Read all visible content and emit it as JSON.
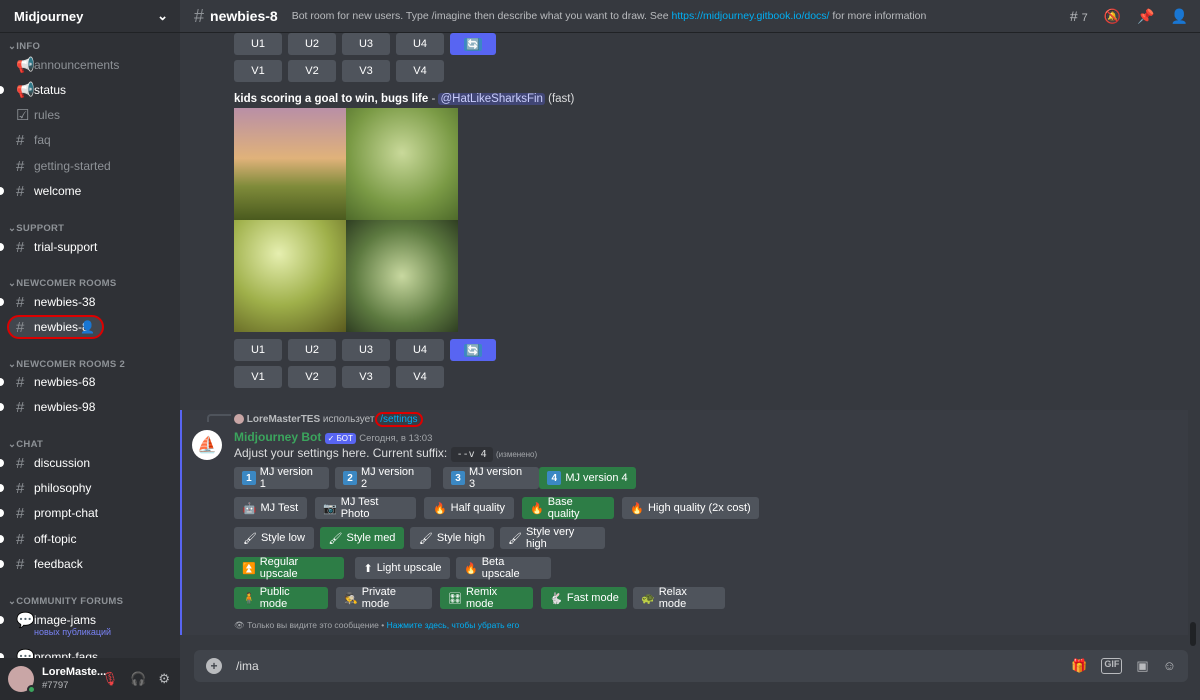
{
  "server": {
    "name": "Midjourney"
  },
  "sidebar": {
    "categories": [
      "INFO",
      "SUPPORT",
      "NEWCOMER ROOMS",
      "NEWCOMER ROOMS 2",
      "CHAT",
      "COMMUNITY FORUMS"
    ],
    "channels": [
      {
        "name": "announcements",
        "icon": "megaphone-icon"
      },
      {
        "name": "status",
        "icon": "megaphone-icon",
        "unread": true
      },
      {
        "name": "rules",
        "icon": "checkbox-icon"
      },
      {
        "name": "faq",
        "icon": "hash-icon"
      },
      {
        "name": "getting-started",
        "icon": "hash-icon"
      },
      {
        "name": "welcome",
        "icon": "hash-icon",
        "unread": true
      },
      {
        "name": "trial-support",
        "icon": "hash-icon",
        "unread": true
      },
      {
        "name": "newbies-38",
        "icon": "threads-icon",
        "unread": true
      },
      {
        "name": "newbies-8",
        "icon": "threads-icon",
        "active": true
      },
      {
        "name": "newbies-68",
        "icon": "threads-icon",
        "unread": true
      },
      {
        "name": "newbies-98",
        "icon": "threads-icon",
        "unread": true
      },
      {
        "name": "discussion",
        "icon": "threads-icon",
        "unread": true
      },
      {
        "name": "philosophy",
        "icon": "hash-icon",
        "unread": true
      },
      {
        "name": "prompt-chat",
        "icon": "threads-icon",
        "unread": true
      },
      {
        "name": "off-topic",
        "icon": "threads-icon",
        "unread": true
      },
      {
        "name": "feedback",
        "icon": "threads-icon",
        "unread": true
      },
      {
        "name": "image-jams",
        "icon": "forum-icon",
        "unread": true,
        "sub": "новых публикаций"
      },
      {
        "name": "prompt-faqs",
        "icon": "forum-icon",
        "unread": true
      }
    ]
  },
  "user": {
    "name": "LoreMaste...",
    "tag": "#7797"
  },
  "header": {
    "channel": "newbies-8",
    "topic_pre": "Bot room for new users. Type /imagine then describe what you want to draw. See ",
    "topic_link": "https://midjourney.gitbook.io/docs/",
    "topic_post": " for more information",
    "threads_count": "7"
  },
  "grid_buttons": {
    "u": [
      "U1",
      "U2",
      "U3",
      "U4"
    ],
    "v": [
      "V1",
      "V2",
      "V3",
      "V4"
    ]
  },
  "message1": {
    "prompt": "kids scoring a goal to win, bugs life",
    "sep": " - ",
    "mention": "@HatLikeSharksFin",
    "mode": "(fast)"
  },
  "message2": {
    "reply_user": "LoreMasterTES",
    "reply_verb": "использует",
    "reply_cmd": "/settings",
    "author": "Midjourney Bot",
    "badge": "✓ БОТ",
    "time": "Сегодня, в 13:03",
    "text": "Adjust your settings here. Current suffix:",
    "suffix": "--v 4",
    "edited": "(изменено)",
    "ephemeral": "Только вы видите это сообщение •",
    "dismiss": "Нажмите здесь, чтобы убрать его"
  },
  "settings_rows": [
    [
      {
        "icon": "1",
        "label": "MJ version 1"
      },
      {
        "icon": "2",
        "label": "MJ version 2"
      },
      {
        "icon": "3",
        "label": "MJ version 3"
      },
      {
        "icon": "4",
        "label": "MJ version 4",
        "on": true
      }
    ],
    [
      {
        "icon": "🤖",
        "label": "MJ Test"
      },
      {
        "icon": "📷",
        "label": "MJ Test Photo"
      },
      {
        "icon": "🔥",
        "label": "Half quality"
      },
      {
        "icon": "🔥",
        "label": "Base quality",
        "on": true
      },
      {
        "icon": "🔥",
        "label": "High quality (2x cost)"
      }
    ],
    [
      {
        "icon": "🖌",
        "label": "Style low"
      },
      {
        "icon": "🖌",
        "label": "Style med",
        "on": true
      },
      {
        "icon": "🖌",
        "label": "Style high"
      },
      {
        "icon": "🖌",
        "label": "Style very high"
      }
    ],
    [
      {
        "icon": "⏫",
        "label": "Regular upscale",
        "on": true
      },
      {
        "icon": "⬆",
        "label": "Light upscale"
      },
      {
        "icon": "🔥",
        "label": "Beta upscale"
      }
    ],
    [
      {
        "icon": "🧍",
        "label": "Public mode",
        "on": true
      },
      {
        "icon": "🕵",
        "label": "Private mode"
      },
      {
        "icon": "🎛",
        "label": "Remix mode",
        "on": true
      },
      {
        "icon": "🐇",
        "label": "Fast mode",
        "on": true
      },
      {
        "icon": "🐢",
        "label": "Relax mode"
      }
    ]
  ],
  "composer": {
    "value": "/ima"
  }
}
